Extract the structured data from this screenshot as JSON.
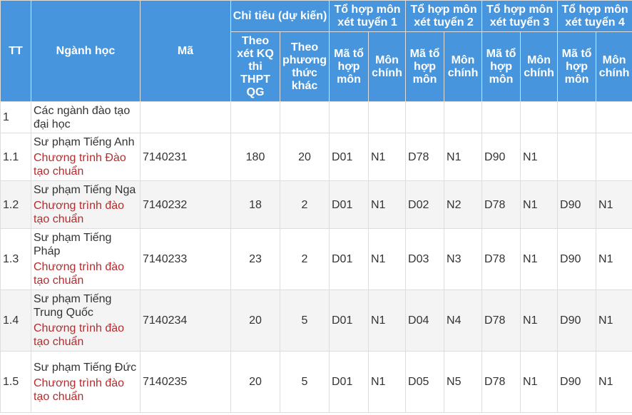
{
  "headers": {
    "tt": "TT",
    "major": "Ngành học",
    "code": "Mã",
    "quota": "Chỉ tiêu (dự kiến)",
    "quota_exam": "Theo xét KQ thi THPT QG",
    "quota_other": "Theo phương thức khác",
    "combo1": "Tổ hợp môn xét tuyển 1",
    "combo2": "Tổ hợp môn xét tuyển 2",
    "combo3": "Tổ hợp môn xét tuyển 3",
    "combo4": "Tổ hợp môn xét tuyển 4",
    "combo_code": "Mã tổ hợp môn",
    "main_subject": "Môn chính"
  },
  "rows": [
    {
      "tt": "1",
      "major": "Các ngành đào tạo đại học",
      "program": "",
      "code": "",
      "exam": "",
      "other": "",
      "c1": "",
      "s1": "",
      "c2": "",
      "s2": "",
      "c3": "",
      "s3": "",
      "c4": "",
      "s4": ""
    },
    {
      "tt": "1.1",
      "major": "Sư phạm Tiếng Anh",
      "program": "Chương trình Đào tạo chuẩn",
      "code": "7140231",
      "exam": "180",
      "other": "20",
      "c1": "D01",
      "s1": "N1",
      "c2": "D78",
      "s2": "N1",
      "c3": "D90",
      "s3": "N1",
      "c4": "",
      "s4": ""
    },
    {
      "tt": "1.2",
      "major": "Sư phạm Tiếng Nga",
      "program": "Chương trình đào tạo chuẩn",
      "code": "7140232",
      "exam": "18",
      "other": "2",
      "c1": "D01",
      "s1": "N1",
      "c2": "D02",
      "s2": "N2",
      "c3": "D78",
      "s3": "N1",
      "c4": "D90",
      "s4": "N1"
    },
    {
      "tt": "1.3",
      "major": "Sư phạm Tiếng Pháp",
      "program": "Chương trình đào tạo chuẩn",
      "code": "7140233",
      "exam": "23",
      "other": "2",
      "c1": "D01",
      "s1": "N1",
      "c2": "D03",
      "s2": "N3",
      "c3": "D78",
      "s3": "N1",
      "c4": "D90",
      "s4": "N1"
    },
    {
      "tt": "1.4",
      "major": "Sư phạm Tiếng Trung Quốc",
      "program": "Chương trình đào tạo chuẩn",
      "code": "7140234",
      "exam": "20",
      "other": "5",
      "c1": "D01",
      "s1": "N1",
      "c2": "D04",
      "s2": "N4",
      "c3": "D78",
      "s3": "N1",
      "c4": "D90",
      "s4": "N1"
    },
    {
      "tt": "1.5",
      "major": "Sư phạm Tiếng Đức",
      "program": "Chương trình đào tạo chuẩn",
      "code": "7140235",
      "exam": "20",
      "other": "5",
      "c1": "D01",
      "s1": "N1",
      "c2": "D05",
      "s2": "N5",
      "c3": "D78",
      "s3": "N1",
      "c4": "D90",
      "s4": "N1"
    }
  ],
  "colors": {
    "header_bg": "#4795dc",
    "program_text": "#b32d2e",
    "alt_row_bg": "#f4f4f4"
  }
}
